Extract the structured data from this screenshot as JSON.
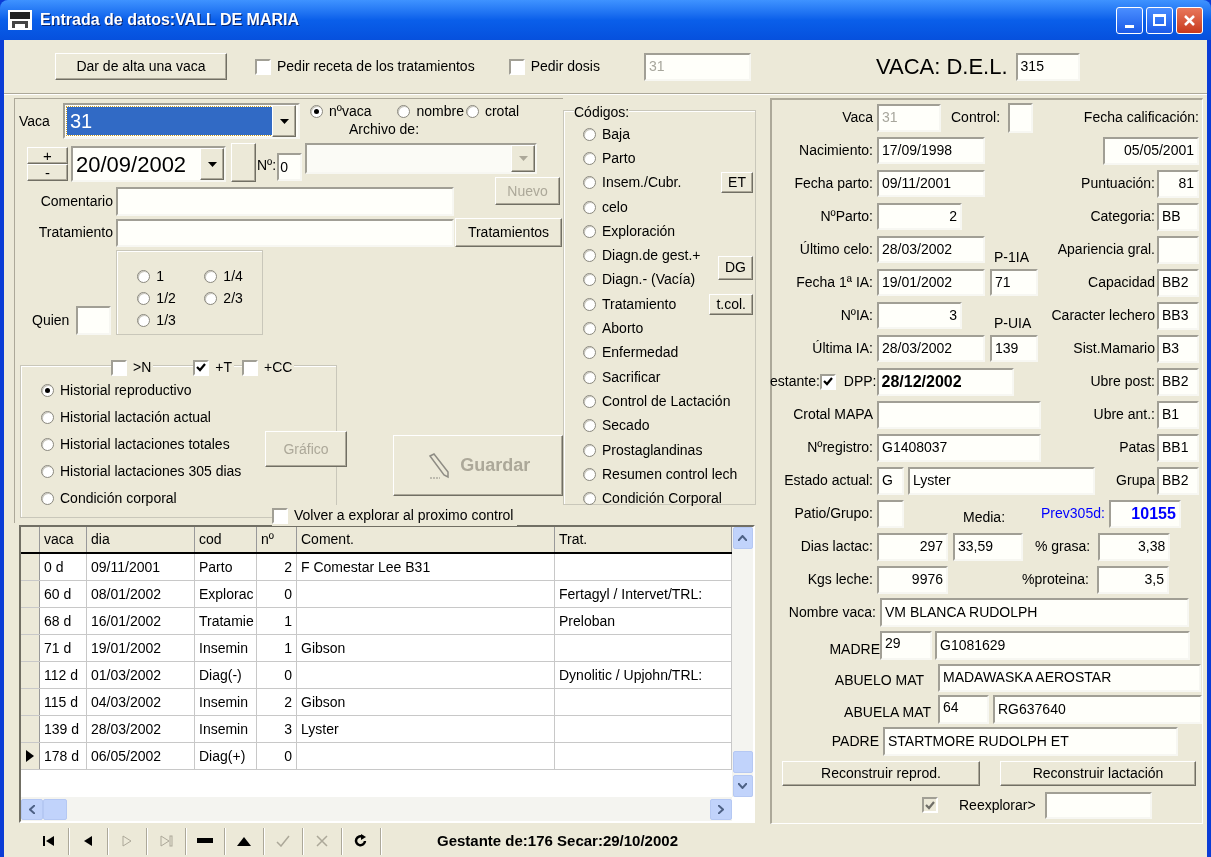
{
  "window": {
    "title": "Entrada de datos:VALL DE MARIA"
  },
  "toolbar": {
    "add_button": "Dar de alta una vaca",
    "checks": [
      {
        "label": "Pedir receta de los tratamientos",
        "checked": false
      },
      {
        "label": "Pedir dosis",
        "checked": false
      }
    ],
    "dose": {
      "value": "31",
      "disabled": true
    },
    "del_label": "VACA: D.E.L.",
    "del_value": "315"
  },
  "entry": {
    "vaca": {
      "label": "Vaca",
      "value": "31",
      "highlighted": true
    },
    "search_by": [
      {
        "label": "nºvaca",
        "selected": true
      },
      {
        "label": "nombre",
        "selected": false
      },
      {
        "label": "crotal",
        "selected": false
      }
    ],
    "archivo": {
      "label": "Archivo de:",
      "disabled": true
    },
    "spin": [
      "+",
      "-"
    ],
    "date": "20/09/2002",
    "num": {
      "label": "Nº:",
      "value": "0"
    },
    "nuevo": {
      "label": "Nuevo",
      "disabled": true
    },
    "comentario_label": "Comentario",
    "tratamiento_label": "Tratamiento",
    "tratamientos_button": "Tratamientos",
    "quien_label": "Quien",
    "fractions": [
      {
        "label": "1",
        "selected": false
      },
      {
        "label": "1/4",
        "selected": false
      },
      {
        "label": "1/2",
        "selected": false
      },
      {
        "label": "2/3",
        "selected": false
      },
      {
        "label": "1/3",
        "selected": false
      }
    ]
  },
  "history": {
    "filters": [
      {
        "label": ">N",
        "checked": false
      },
      {
        "label": "+T",
        "checked": true
      },
      {
        "label": "+CC",
        "checked": false
      }
    ],
    "views": [
      {
        "label": "Historial reproductivo",
        "selected": true
      },
      {
        "label": "Historial lactación actual",
        "selected": false
      },
      {
        "label": "Historial lactaciones totales",
        "selected": false
      },
      {
        "label": "Historial lactaciones 305 dias",
        "selected": false
      },
      {
        "label": "Condición corporal",
        "selected": false
      }
    ],
    "grafico": {
      "label": "Gráfico",
      "disabled": true
    },
    "guardar": {
      "label": "Guardar",
      "disabled": true
    },
    "revisit": {
      "label": "Volver a explorar al proximo control",
      "checked": false
    }
  },
  "codigos": {
    "title": "Códigos:",
    "items": [
      {
        "label": "Baja",
        "selected": false
      },
      {
        "label": "Parto",
        "selected": false
      },
      {
        "label": "Insem./Cubr.",
        "selected": false,
        "button": "ET"
      },
      {
        "label": "celo",
        "selected": false
      },
      {
        "label": "Exploración",
        "selected": false
      },
      {
        "label": "Diagn.de gest.+",
        "selected": false,
        "button": "DG"
      },
      {
        "label": "Diagn.- (Vacía)",
        "selected": false
      },
      {
        "label": "Tratamiento",
        "selected": false,
        "button": "t.col."
      },
      {
        "label": "Aborto",
        "selected": false
      },
      {
        "label": "Enfermedad",
        "selected": false
      },
      {
        "label": "Sacrificar",
        "selected": false
      },
      {
        "label": "Control de Lactación",
        "selected": false
      },
      {
        "label": "Secado",
        "selected": false
      },
      {
        "label": "Prostaglandinas",
        "selected": false
      },
      {
        "label": "Resumen control lech",
        "selected": false
      },
      {
        "label": "Condición Corporal",
        "selected": false
      }
    ]
  },
  "grid": {
    "columns": [
      "vaca",
      "dia",
      "cod",
      "nº",
      "Coment.",
      "Trat."
    ],
    "rows": [
      {
        "current": false,
        "cells": [
          "0 d",
          "09/11/2001",
          "Parto",
          "2",
          "F Comestar Lee B31",
          null
        ]
      },
      {
        "current": false,
        "cells": [
          "60 d",
          "08/01/2002",
          "Explorac",
          "0",
          null,
          "Fertagyl / Intervet/TRL:"
        ]
      },
      {
        "current": false,
        "cells": [
          "68 d",
          "16/01/2002",
          "Tratamie",
          "1",
          null,
          "Preloban"
        ]
      },
      {
        "current": false,
        "cells": [
          "71 d",
          "19/01/2002",
          "Insemin",
          "1",
          "Gibson",
          null
        ]
      },
      {
        "current": false,
        "cells": [
          "112 d",
          "01/03/2002",
          "Diag(-)",
          "0",
          null,
          "Dynolitic / Upjohn/TRL:"
        ]
      },
      {
        "current": false,
        "cells": [
          "115 d",
          "04/03/2002",
          "Insemin",
          "2",
          "Gibson",
          null
        ]
      },
      {
        "current": false,
        "cells": [
          "139 d",
          "28/03/2002",
          "Insemin",
          "3",
          "Lyster",
          null
        ]
      },
      {
        "current": true,
        "cells": [
          "178 d",
          "06/05/2002",
          "Diag(+)",
          "0",
          null,
          null
        ]
      }
    ]
  },
  "navigator": {
    "buttons": [
      {
        "kind": "first",
        "disabled": false
      },
      {
        "kind": "prior",
        "disabled": false
      },
      {
        "kind": "next",
        "disabled": true
      },
      {
        "kind": "last",
        "disabled": true
      },
      {
        "kind": "delete",
        "disabled": false
      },
      {
        "kind": "insert",
        "disabled": false
      },
      {
        "kind": "post",
        "disabled": true
      },
      {
        "kind": "cancel",
        "disabled": true
      },
      {
        "kind": "refresh",
        "disabled": false
      }
    ],
    "status": "Gestante de:176 Secar:29/10/2002"
  },
  "cow": {
    "vaca": {
      "label": "Vaca",
      "value": "31",
      "disabled": true
    },
    "control_label": "Control:",
    "rows": [
      {
        "kind": "field",
        "label": "Nacimiento:",
        "value": "17/09/1998"
      },
      {
        "kind": "field",
        "label": "Fecha parto:",
        "value": "09/11/2001"
      },
      {
        "kind": "number",
        "label": "NºParto:",
        "value": "2"
      },
      {
        "kind": "field",
        "label": "Último celo:",
        "value": "28/03/2002"
      },
      {
        "kind": "field",
        "label": "Fecha 1ª IA:",
        "value": "19/01/2002",
        "extra": "71",
        "extra_label": "P-1IA"
      },
      {
        "kind": "number",
        "label": "NºIA:",
        "value": "3"
      },
      {
        "kind": "field",
        "label": "Última IA:",
        "value": "28/03/2002",
        "extra": "139",
        "extra_label": "P-UIA"
      },
      {
        "kind": "gestante",
        "label": "estante:",
        "checked": true,
        "dpp_label": "DPP:",
        "value": "28/12/2002"
      },
      {
        "kind": "wide",
        "label": "Crotal MAPA"
      },
      {
        "kind": "wide",
        "label": "Nºregistro:",
        "value": "G1408037"
      },
      {
        "kind": "estado",
        "label": "Estado actual:",
        "code": "G",
        "value": "Lyster"
      }
    ],
    "calificacion": {
      "label": "Fecha calificación:",
      "date": "05/05/2001",
      "items": [
        {
          "label": "Puntuación:",
          "value": "81",
          "kind": "number"
        },
        {
          "label": "Categoria:",
          "value": "BB"
        },
        {
          "label": "Apariencia gral."
        },
        {
          "label": "Capacidad",
          "value": "BB2"
        },
        {
          "label": "Caracter lechero",
          "value": "BB3"
        },
        {
          "label": "Sist.Mamario",
          "value": "B3"
        },
        {
          "label": "Ubre post:",
          "value": "BB2"
        },
        {
          "label": "Ubre ant.:",
          "value": "B1"
        },
        {
          "label": "Patas",
          "value": "BB1"
        },
        {
          "label": "Grupa",
          "value": "BB2"
        }
      ]
    },
    "patio_label": "Patio/Grupo:",
    "media_label": "Media:",
    "prev_label": "Prev305d:",
    "prev_value": "10155",
    "dias": {
      "label": "Dias lactac:",
      "value": "297",
      "media": "33,59"
    },
    "grasa": {
      "label": "% grasa:",
      "value": "3,38"
    },
    "kgs": {
      "label": "Kgs leche:",
      "value": "9976"
    },
    "proteina": {
      "label": "%proteina:",
      "value": "3,5"
    },
    "nombre": {
      "label": "Nombre vaca:",
      "value": "VM BLANCA RUDOLPH"
    },
    "madre": {
      "label": "MADRE",
      "num": "29",
      "reg": "G1081629"
    },
    "abuelo": {
      "label": "ABUELO MAT",
      "value": "MADAWASKA AEROSTAR"
    },
    "abuela": {
      "label": "ABUELA MAT",
      "num": "64",
      "reg": "RG637640"
    },
    "padre": {
      "label": "PADRE",
      "value": "STARTMORE RUDOLPH ET"
    },
    "buttons": [
      "Reconstruir reprod.",
      "Reconstruir lactación"
    ],
    "reexplorar": {
      "label": "Reexplorar>",
      "checked": true,
      "disabled": true
    }
  }
}
